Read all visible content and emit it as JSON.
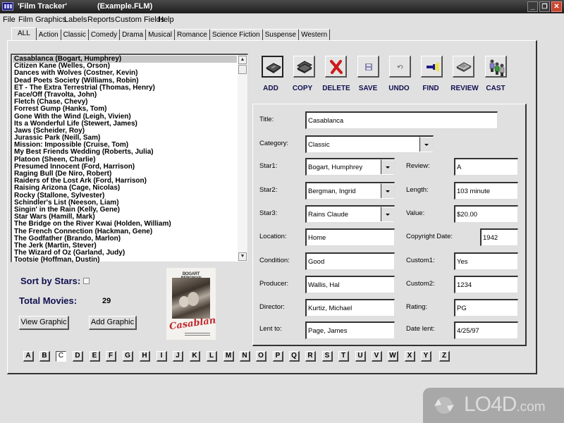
{
  "window": {
    "title": "'Film Tracker'",
    "file": "(Example.FLM)",
    "controls": {
      "minimize": "_",
      "restore": "❐",
      "close": "✕"
    }
  },
  "menu": [
    "File",
    "Film",
    "Graphics",
    "Labels",
    "Reports",
    "Custom Fields",
    "Help"
  ],
  "tabs": {
    "active": "ALL",
    "items": [
      "ALL",
      "Action",
      "Classic",
      "Comedy",
      "Drama",
      "Musical",
      "Romance",
      "Science Fiction",
      "Suspense",
      "Western"
    ]
  },
  "movie_list": {
    "selected_index": 0,
    "items": [
      "Casablanca (Bogart, Humphrey)",
      "Citizen Kane (Welles, Orson)",
      "Dances with Wolves (Costner, Kevin)",
      "Dead Poets Society (Williams, Robin)",
      "ET - The Extra Terrestrial (Thomas, Henry)",
      "Face/Off (Travolta, John)",
      "Fletch (Chase, Chevy)",
      "Forrest Gump (Hanks, Tom)",
      "Gone With the Wind (Leigh, Vivien)",
      "Its a Wonderful Life (Stewert, James)",
      "Jaws (Scheider, Roy)",
      "Jurassic Park (Neill, Sam)",
      "Mission: Impossible (Cruise, Tom)",
      "My Best Friends Wedding (Roberts, Julia)",
      "Platoon (Sheen, Charlie)",
      "Presumed Innocent (Ford, Harrison)",
      "Raging Bull (De Niro, Robert)",
      "Raiders of the Lost Ark (Ford, Harrison)",
      "Raising Arizona (Cage, Nicolas)",
      "Rocky (Stallone, Sylvester)",
      "Schindler's List (Neeson, Liam)",
      "Singin' in the Rain (Kelly, Gene)",
      "Star Wars (Hamill, Mark)",
      "The Bridge on the River Kwai (Holden, William)",
      "The French Connection (Hackman, Gene)",
      "The Godfather (Brando, Marlon)",
      "The Jerk (Martin, Stever)",
      "The Wizard of Oz (Garland, Judy)",
      "Tootsie (Hoffman, Dustin)"
    ],
    "scroll_up": "▲",
    "scroll_down": "▼"
  },
  "sort_by_stars": {
    "label": "Sort by Stars:",
    "checked": false
  },
  "total_movies": {
    "label": "Total Movies:",
    "value": "29"
  },
  "buttons": {
    "view_graphic": "View Graphic",
    "add_graphic": "Add Graphic"
  },
  "poster": {
    "header": "BOGART BERGMAN HENREID",
    "title": "Casablanca"
  },
  "toolbar": [
    {
      "id": "add",
      "label": "ADD",
      "icon": "videotape-icon"
    },
    {
      "id": "copy",
      "label": "COPY",
      "icon": "copy-tapes-icon"
    },
    {
      "id": "delete",
      "label": "DELETE",
      "icon": "red-x-icon"
    },
    {
      "id": "save",
      "label": "SAVE",
      "icon": "floppy-disk-icon"
    },
    {
      "id": "undo",
      "label": "UNDO",
      "icon": "undo-arrow-icon"
    },
    {
      "id": "find",
      "label": "FIND",
      "icon": "flashlight-icon"
    },
    {
      "id": "review",
      "label": "REVIEW",
      "icon": "newspaper-icon"
    },
    {
      "id": "cast",
      "label": "CAST",
      "icon": "people-icon"
    }
  ],
  "form": {
    "title": {
      "label": "Title:",
      "value": "Casablanca"
    },
    "category": {
      "label": "Category:",
      "value": "Classic"
    },
    "star1": {
      "label": "Star1:",
      "value": "Bogart, Humphrey"
    },
    "star2": {
      "label": "Star2:",
      "value": "Bergman, Ingrid"
    },
    "star3": {
      "label": "Star3:",
      "value": "Rains Claude"
    },
    "review": {
      "label": "Review:",
      "value": "A"
    },
    "length": {
      "label": "Length:",
      "value": "103 minute"
    },
    "value": {
      "label": "Value:",
      "value": "$20.00"
    },
    "location": {
      "label": "Location:",
      "value": "Home"
    },
    "copyright_date": {
      "label": "Copyright Date:",
      "value": "1942"
    },
    "condition": {
      "label": "Condition:",
      "value": "Good"
    },
    "custom1": {
      "label": "Custom1:",
      "value": "Yes"
    },
    "producer": {
      "label": "Producer:",
      "value": "Wallis, Hal"
    },
    "custom2": {
      "label": "Custom2:",
      "value": "1234"
    },
    "director": {
      "label": "Director:",
      "value": "Kurtiz, Michael"
    },
    "rating": {
      "label": "Rating:",
      "value": "PG"
    },
    "lent_to": {
      "label": "Lent to:",
      "value": "Page, James"
    },
    "date_lent": {
      "label": "Date lent:",
      "value": "4/25/97"
    }
  },
  "alphabet": {
    "pressed": "C",
    "letters": [
      "A",
      "B",
      "C",
      "D",
      "E",
      "F",
      "G",
      "H",
      "I",
      "J",
      "K",
      "L",
      "M",
      "N",
      "O",
      "P",
      "Q",
      "R",
      "S",
      "T",
      "U",
      "V",
      "W",
      "X",
      "Y",
      "Z"
    ]
  },
  "watermark": {
    "text": "LO4D",
    "suffix": ".com"
  },
  "colors": {
    "label_navy": "#101050",
    "selection": "#c8c8c8",
    "delete_red": "#cc1a1a",
    "poster_red": "#c0282c"
  }
}
